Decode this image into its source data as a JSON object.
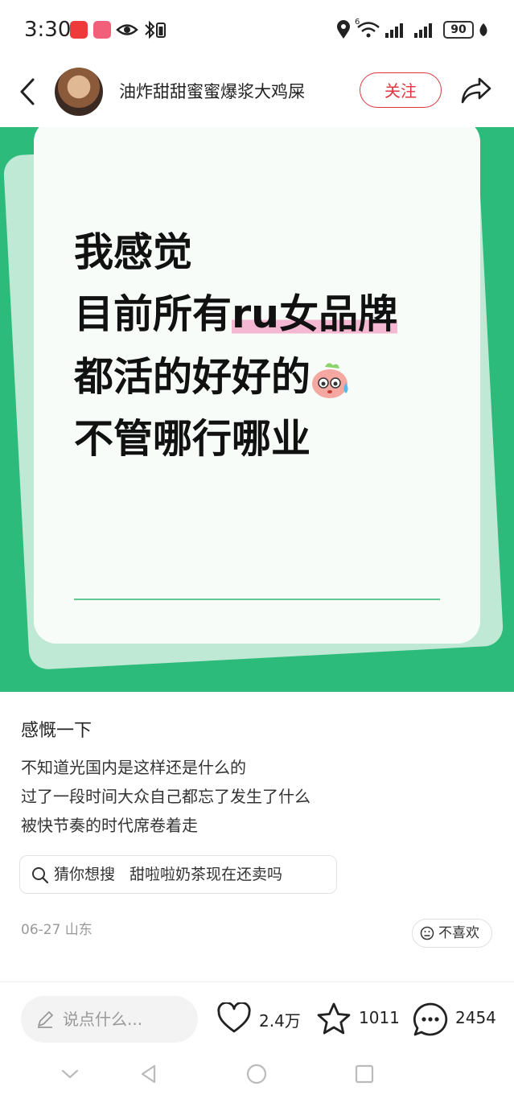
{
  "status_bar": {
    "time": "3:30",
    "network": "6",
    "battery": "90"
  },
  "header": {
    "author": "油炸甜甜蜜蜜爆浆大鸡屎",
    "follow_label": "关注"
  },
  "hero": {
    "line1": "我感觉",
    "line2_prefix": "目前所有",
    "line2_highlight": "ru女品牌",
    "line3": "都活的好好的",
    "line4": "不管哪行哪业"
  },
  "post": {
    "title": "感慨一下",
    "body": [
      "不知道光国内是这样还是什么的",
      "过了一段时间大众自己都忘了发生了什么",
      "被快节奏的时代席卷着走"
    ],
    "search_prefix": "猜你想搜",
    "search_query": "甜啦啦奶茶现在还卖吗",
    "date_location": "06-27 山东",
    "dislike_label": "不喜欢"
  },
  "bottom_bar": {
    "comment_placeholder": "说点什么...",
    "likes": "2.4万",
    "favorites": "1011",
    "comments": "2454"
  },
  "colors": {
    "accent_red": "#e0353f",
    "hero_green": "#2dbb7b",
    "highlight_pink": "#f5b8d2"
  }
}
